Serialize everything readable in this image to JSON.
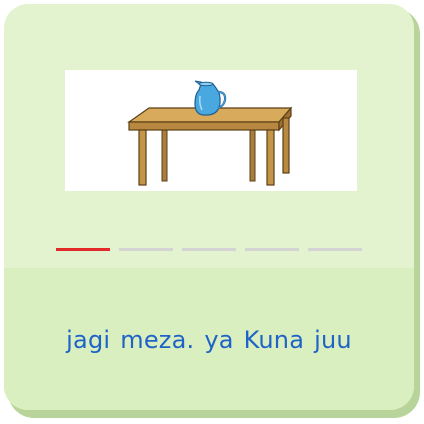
{
  "exercise": {
    "progress": {
      "total_steps": 5,
      "current_step": 1
    },
    "words": [
      "jagi",
      "meza.",
      "ya",
      "Kuna",
      "juu"
    ],
    "colors": {
      "card_background": "#e4f3cf",
      "card_bottom": "#d9efbf",
      "card_shadow": "#b8d49a",
      "word_text": "#1f63c8",
      "progress_active": "#e32a2a",
      "progress_inactive": "#d4d4d4"
    },
    "illustration": {
      "objects": [
        "table",
        "jug"
      ]
    }
  }
}
